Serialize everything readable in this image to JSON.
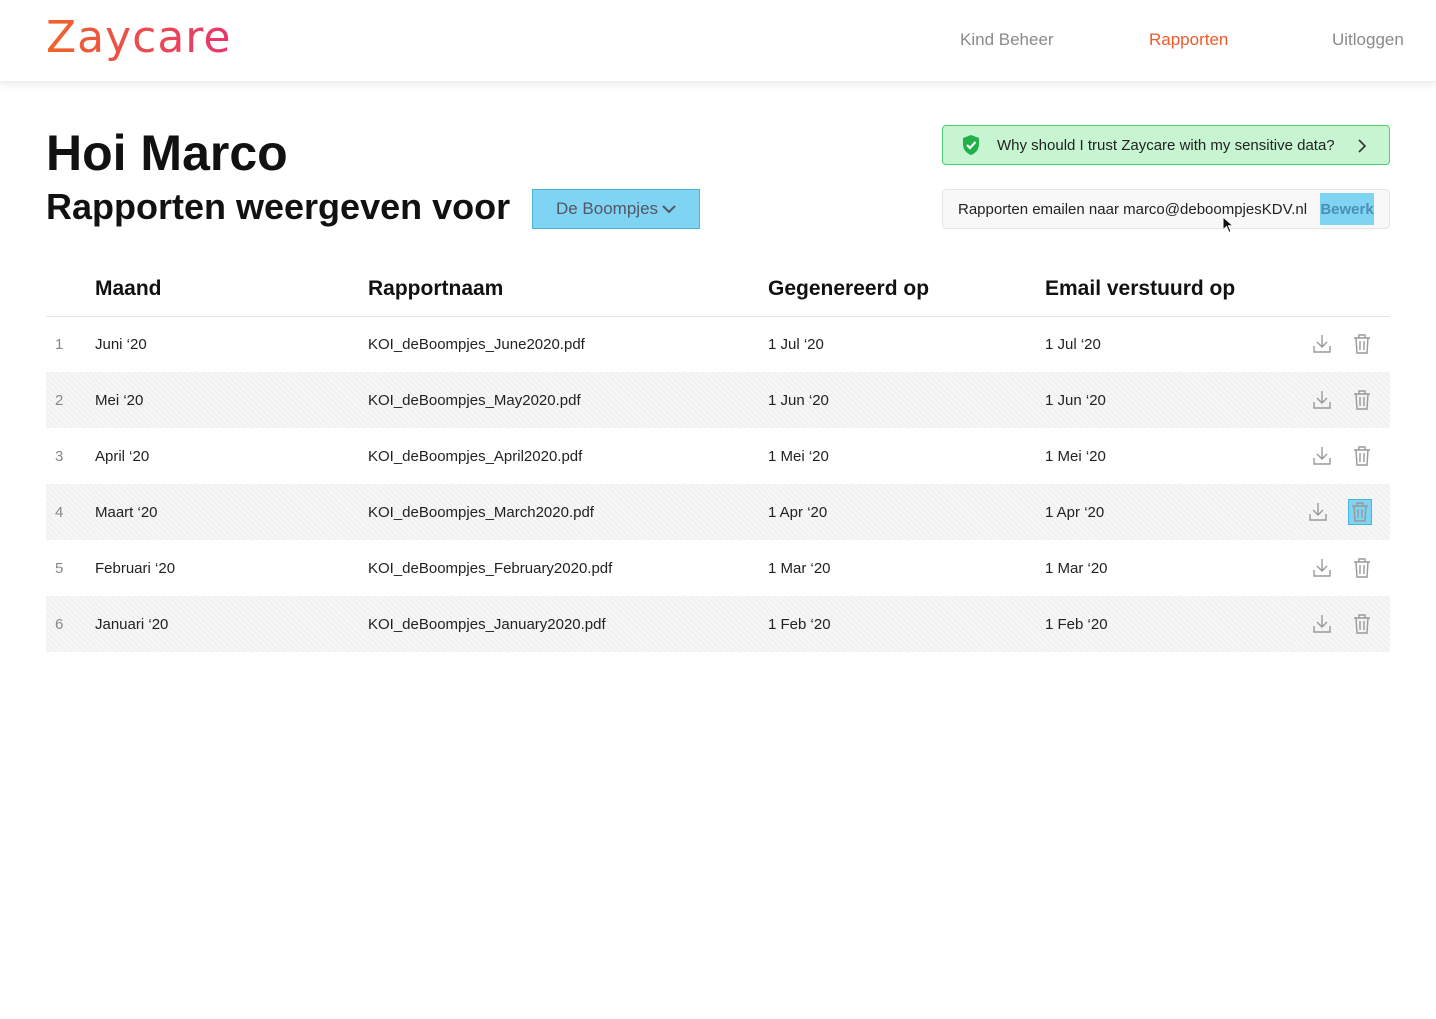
{
  "header": {
    "logo": "Zaycare",
    "nav": [
      {
        "label": "Kind Beheer",
        "active": false
      },
      {
        "label": "Rapporten",
        "active": true
      },
      {
        "label": "Uitloggen",
        "active": false
      }
    ]
  },
  "main": {
    "greeting": "Hoi Marco",
    "subtitle": "Rapporten weergeven voor",
    "location_select": "De Boompjes",
    "trust_banner": "Why should I trust Zaycare with my sensitive data?",
    "email_notice": "Rapporten emailen naar marco@deboompjesKDV.nl",
    "edit_label": "Bewerk"
  },
  "table": {
    "headers": [
      "Maand",
      "Rapportnaam",
      "Gegenereerd op",
      "Email verstuurd op"
    ],
    "rows": [
      {
        "num": "1",
        "maand": "Juni ‘20",
        "naam": "KOI_deBoompjes_June2020.pdf",
        "gen": "1 Jul ‘20",
        "mail": "1 Jul ‘20"
      },
      {
        "num": "2",
        "maand": "Mei ‘20",
        "naam": "KOI_deBoompjes_May2020.pdf",
        "gen": "1 Jun ‘20",
        "mail": "1 Jun ‘20"
      },
      {
        "num": "3",
        "maand": "April ‘20",
        "naam": "KOI_deBoompjes_April2020.pdf",
        "gen": "1 Mei ‘20",
        "mail": "1 Mei ‘20"
      },
      {
        "num": "4",
        "maand": "Maart ‘20",
        "naam": "KOI_deBoompjes_March2020.pdf",
        "gen": "1 Apr ‘20",
        "mail": "1 Apr ‘20"
      },
      {
        "num": "5",
        "maand": "Februari ‘20",
        "naam": "KOI_deBoompjes_February2020.pdf",
        "gen": "1 Mar ‘20",
        "mail": "1 Mar ‘20"
      },
      {
        "num": "6",
        "maand": "Januari ‘20",
        "naam": "KOI_deBoompjes_January2020.pdf",
        "gen": "1 Feb ‘20",
        "mail": "1 Feb ‘20"
      }
    ]
  },
  "colors": {
    "accent": "#ee5a2a",
    "highlight": "#7fd3f3",
    "trust_bg": "#c8f5d1"
  },
  "icons": [
    "shield-icon",
    "chevron-right-icon",
    "chevron-down-icon",
    "download-icon",
    "trash-icon"
  ]
}
